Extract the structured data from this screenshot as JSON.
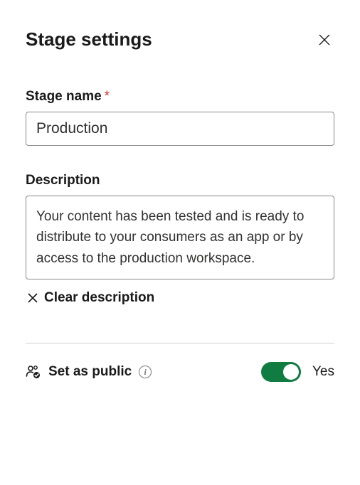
{
  "header": {
    "title": "Stage settings"
  },
  "stage_name": {
    "label": "Stage name",
    "required_mark": "*",
    "value": "Production"
  },
  "description": {
    "label": "Description",
    "value": "Your content has been tested and is ready to distribute to your consumers as an app or by access to the production workspace.",
    "clear_label": "Clear description"
  },
  "public": {
    "label": "Set as public",
    "state_label": "Yes",
    "on": true
  },
  "colors": {
    "toggle_on": "#107c41",
    "required": "#d13438"
  }
}
